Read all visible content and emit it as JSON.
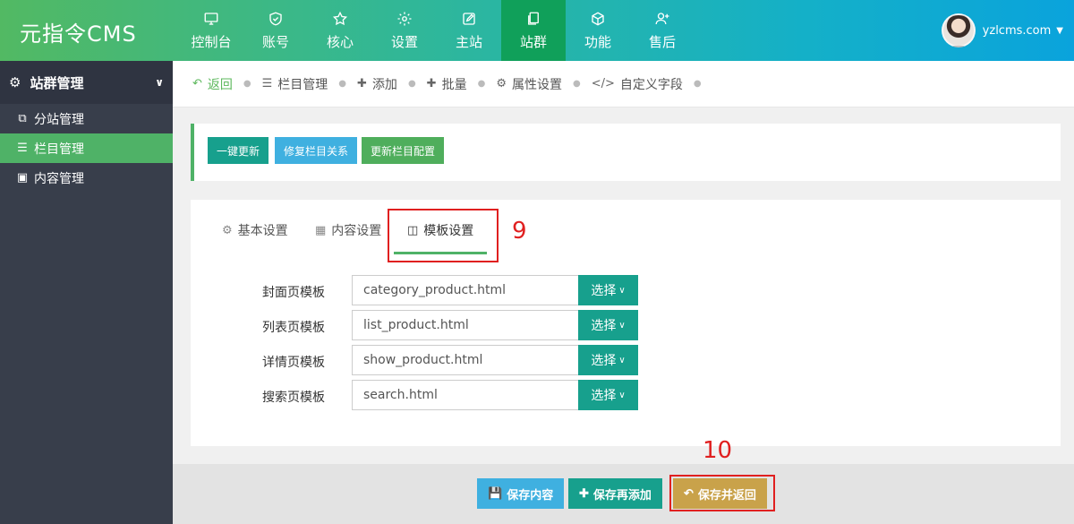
{
  "header": {
    "logo": "元指令CMS",
    "nav": [
      {
        "label": "控制台",
        "icon": "monitor-icon"
      },
      {
        "label": "账号",
        "icon": "shield-icon"
      },
      {
        "label": "核心",
        "icon": "star-icon"
      },
      {
        "label": "设置",
        "icon": "gear-icon"
      },
      {
        "label": "主站",
        "icon": "edit-icon"
      },
      {
        "label": "站群",
        "icon": "copy-icon"
      },
      {
        "label": "功能",
        "icon": "cube-icon"
      },
      {
        "label": "售后",
        "icon": "user-plus-icon"
      }
    ],
    "active_nav": "站群",
    "user": "yzlcms.com"
  },
  "sidebar": {
    "title": "站群管理",
    "items": [
      {
        "label": "分站管理",
        "icon": "copy-icon"
      },
      {
        "label": "栏目管理",
        "icon": "list-icon"
      },
      {
        "label": "内容管理",
        "icon": "note-icon"
      }
    ],
    "active": "栏目管理"
  },
  "breadcrumbs": {
    "back": "返回",
    "items": [
      "栏目管理",
      "添加",
      "批量",
      "属性设置",
      "自定义字段"
    ]
  },
  "actions": {
    "update_all": "一键更新",
    "repair": "修复栏目关系",
    "update_config": "更新栏目配置"
  },
  "tabs": {
    "basic": "基本设置",
    "content": "内容设置",
    "template": "模板设置"
  },
  "annotations": {
    "step9": "9",
    "step10": "10"
  },
  "form": {
    "select_label": "选择",
    "rows": [
      {
        "label": "封面页模板",
        "value": "category_product.html"
      },
      {
        "label": "列表页模板",
        "value": "list_product.html"
      },
      {
        "label": "详情页模板",
        "value": "show_product.html"
      },
      {
        "label": "搜索页模板",
        "value": "search.html"
      }
    ]
  },
  "footer": {
    "save": "保存内容",
    "save_add": "保存再添加",
    "save_back": "保存并返回"
  },
  "colors": {
    "accent": "#4fb267",
    "teal": "#17a08d",
    "blue": "#3fb0e0",
    "gold": "#c9a24a",
    "annotation": "#e02020"
  }
}
